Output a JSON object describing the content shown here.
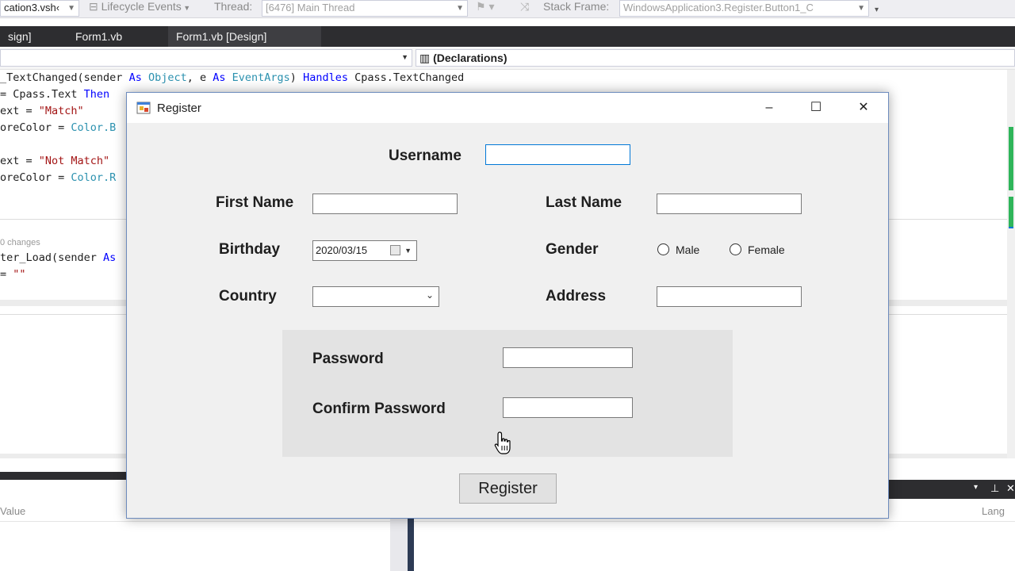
{
  "vs": {
    "toolbar": {
      "project_combo": "cation3.vsh‹",
      "lifecycle": "Lifecycle Events",
      "thread_label": "Thread:",
      "thread_value": "[6476] Main Thread",
      "stack_label": "Stack Frame:",
      "stack_value": "WindowsApplication3.Register.Button1_C"
    },
    "tabs": [
      "sign]",
      "Form1.vb",
      "Form1.vb [Design]"
    ],
    "nav_right": "(Declarations)",
    "code_lines": [
      {
        "plain_before": "_TextChanged(sender ",
        "kw1": "As",
        "ty1": " Object",
        "mid": ", e ",
        "kw2": "As",
        "ty2": " EventArgs",
        "plain_mid": ") ",
        "kw3": "Handles",
        "plain_after": " Cpass.TextChanged"
      },
      {
        "text_a": "= Cpass.Text ",
        "kw": "Then"
      },
      {
        "text_a": "ext = ",
        "str": "\"Match\""
      },
      {
        "text_a": "oreColor = ",
        "ty": "Color.B"
      },
      {
        "text_a": "ext = ",
        "str": "\"Not Match\""
      },
      {
        "text_a": "oreColor = ",
        "ty": "Color.R"
      },
      {
        "text_a": "ter_Load(sender ",
        "kw": "As"
      },
      {
        "text_a": "= ",
        "str": "\"\""
      }
    ],
    "codelens": "0 changes",
    "bottom": {
      "col_value": "Value",
      "col_lang": "Lang"
    },
    "colors": {
      "dark_chrome": "#2d2d30",
      "green_marker": "#2fb55a",
      "blue_marker": "#0078d7"
    }
  },
  "window": {
    "title": "Register",
    "minimize": "–",
    "maximize": "☐",
    "close": "✕"
  },
  "form": {
    "username_label": "Username",
    "first_name_label": "First Name",
    "last_name_label": "Last Name",
    "birthday_label": "Birthday",
    "birthday_value": "2020/03/15",
    "gender_label": "Gender",
    "gender_options": [
      "Male",
      "Female"
    ],
    "country_label": "Country",
    "address_label": "Address",
    "password_label": "Password",
    "confirm_password_label": "Confirm Password",
    "register_button": "Register"
  }
}
